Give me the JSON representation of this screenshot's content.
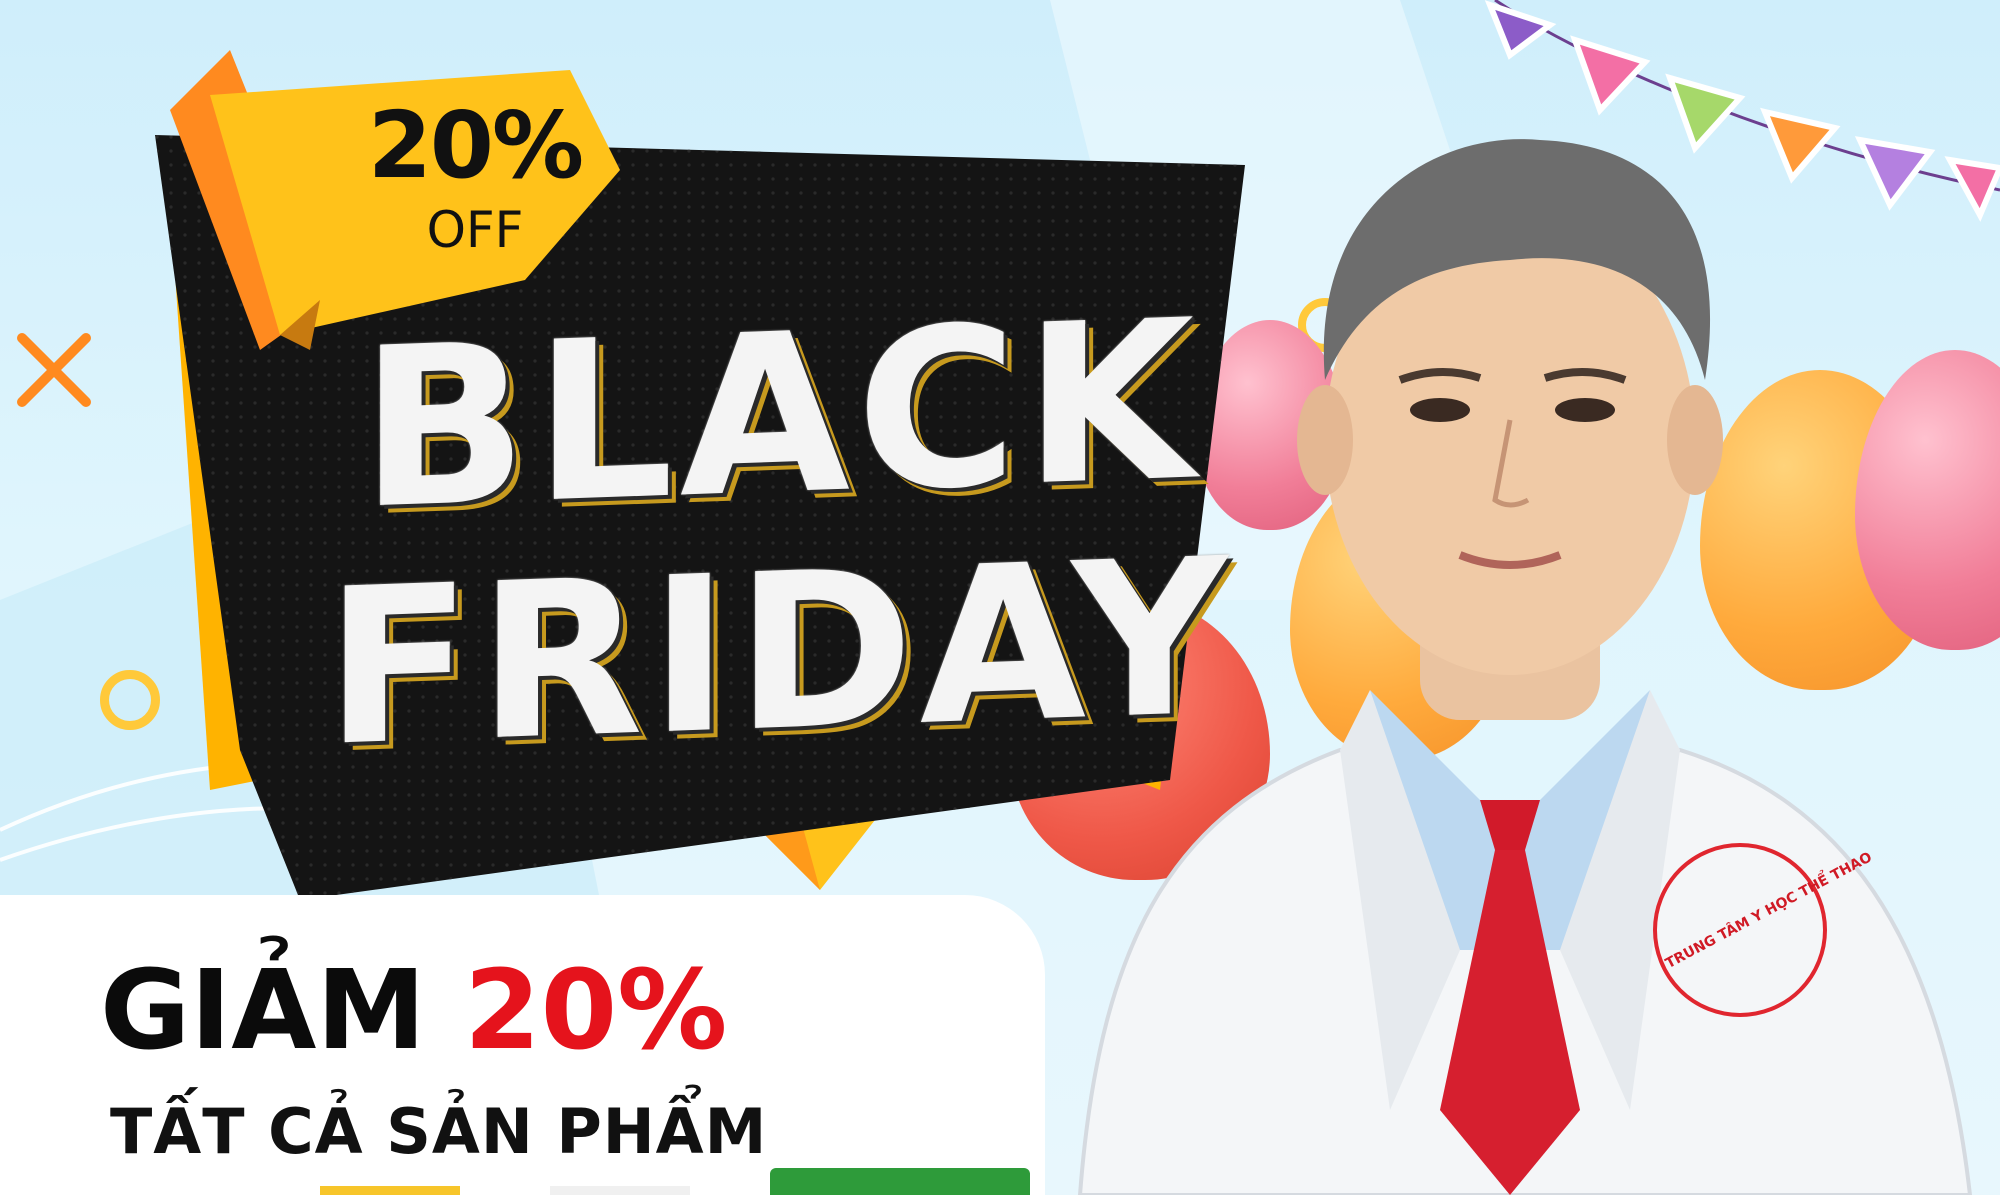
{
  "promo": {
    "tag_percent": "20%",
    "tag_off": "OFF",
    "headline_line1": "BLACK",
    "headline_line2": "FRIDAY",
    "discount_word": "GIẢM",
    "discount_percent": "20%",
    "subline": "TẤT CẢ SẢN PHẨM"
  },
  "badge": {
    "coat_text": "TRUNG TÂM Y HỌC THỂ THAO"
  },
  "colors": {
    "background": "#d8f2fc",
    "accent_yellow": "#ffc21a",
    "accent_orange": "#ff8a1f",
    "panel_black": "#141414",
    "discount_red": "#e5131c"
  },
  "icons": [
    "cross-icon",
    "ring-icon",
    "bunting-flags",
    "balloon"
  ]
}
